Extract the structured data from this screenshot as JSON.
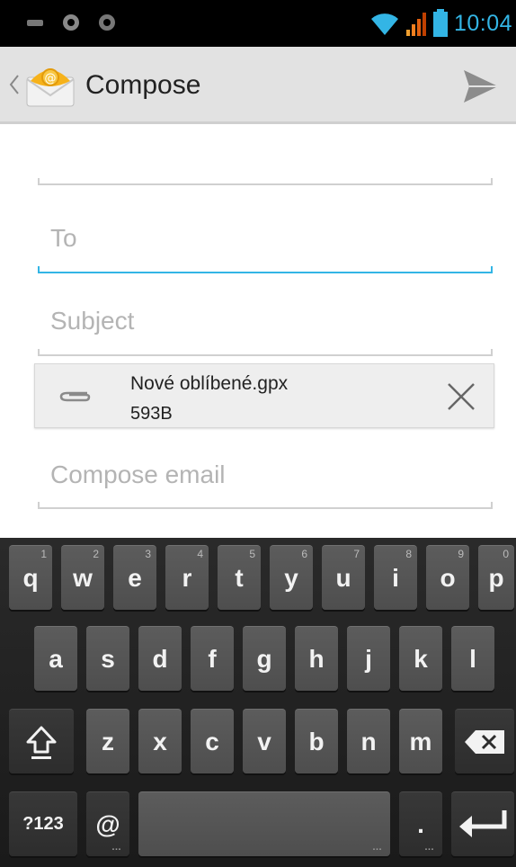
{
  "status_bar": {
    "time": "10:04",
    "icons": [
      "notification-icon",
      "android-icon",
      "android-icon",
      "wifi-icon",
      "signal-icon",
      "battery-icon"
    ]
  },
  "action_bar": {
    "title": "Compose",
    "icons": [
      "up-caret-icon",
      "email-app-icon",
      "send-icon"
    ]
  },
  "form": {
    "from": {
      "value": ""
    },
    "to": {
      "placeholder": "To",
      "value": "",
      "focused": true
    },
    "subject": {
      "placeholder": "Subject",
      "value": ""
    },
    "body": {
      "placeholder": "Compose email",
      "value": ""
    }
  },
  "attachment": {
    "filename": "Nové oblíbené.gpx",
    "size": "593B",
    "icons": [
      "paperclip-icon",
      "remove-icon"
    ]
  },
  "keyboard": {
    "row1": [
      {
        "label": "q",
        "hint": "1"
      },
      {
        "label": "w",
        "hint": "2"
      },
      {
        "label": "e",
        "hint": "3"
      },
      {
        "label": "r",
        "hint": "4"
      },
      {
        "label": "t",
        "hint": "5"
      },
      {
        "label": "y",
        "hint": "6"
      },
      {
        "label": "u",
        "hint": "7"
      },
      {
        "label": "i",
        "hint": "8"
      },
      {
        "label": "o",
        "hint": "9"
      },
      {
        "label": "p",
        "hint": "0"
      }
    ],
    "row2": [
      "a",
      "s",
      "d",
      "f",
      "g",
      "h",
      "j",
      "k",
      "l"
    ],
    "row3": [
      "z",
      "x",
      "c",
      "v",
      "b",
      "n",
      "m"
    ],
    "symbols_label": "?123",
    "at_label": "@",
    "period_label": ".",
    "icons": [
      "shift-icon",
      "backspace-icon",
      "enter-icon"
    ]
  },
  "colors": {
    "accent": "#33b5e5",
    "action_bar": "#e2e2e2",
    "keyboard_bg": "#1e1e1e",
    "key": "#555555"
  }
}
